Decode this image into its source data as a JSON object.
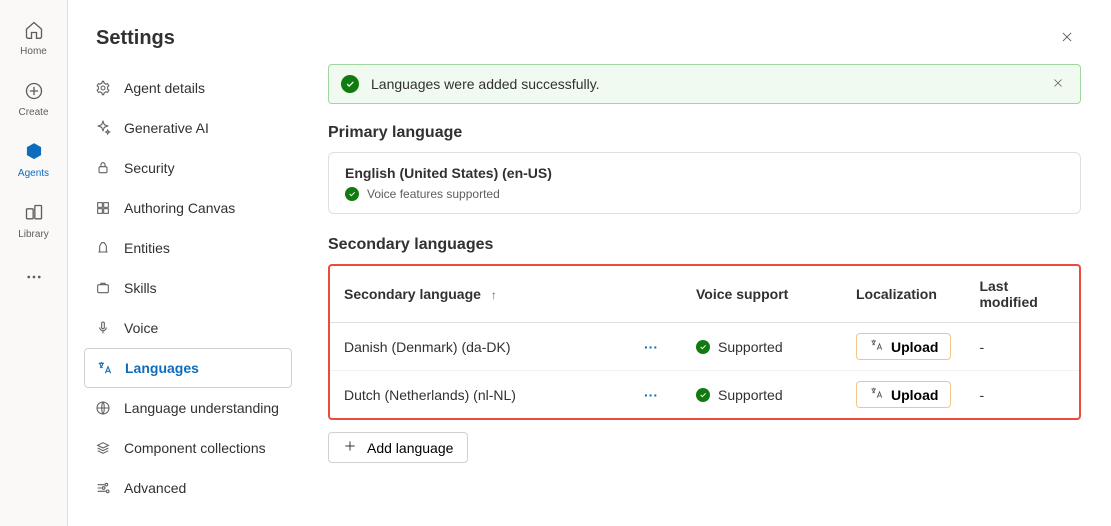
{
  "rail": {
    "home": {
      "label": "Home"
    },
    "create": {
      "label": "Create"
    },
    "agents": {
      "label": "Agents"
    },
    "library": {
      "label": "Library"
    }
  },
  "page": {
    "title": "Settings"
  },
  "settings_nav": {
    "items": [
      {
        "key": "agent-details",
        "label": "Agent details"
      },
      {
        "key": "generative-ai",
        "label": "Generative AI"
      },
      {
        "key": "security",
        "label": "Security"
      },
      {
        "key": "authoring-canvas",
        "label": "Authoring Canvas"
      },
      {
        "key": "entities",
        "label": "Entities"
      },
      {
        "key": "skills",
        "label": "Skills"
      },
      {
        "key": "voice",
        "label": "Voice"
      },
      {
        "key": "languages",
        "label": "Languages",
        "active": true
      },
      {
        "key": "language-understanding",
        "label": "Language understanding"
      },
      {
        "key": "component-collections",
        "label": "Component collections"
      },
      {
        "key": "advanced",
        "label": "Advanced"
      }
    ]
  },
  "banner": {
    "message": "Languages were added successfully."
  },
  "primary": {
    "heading": "Primary language",
    "name": "English (United States) (en-US)",
    "voice_note": "Voice features supported"
  },
  "secondary": {
    "heading": "Secondary languages",
    "columns": {
      "lang": "Secondary language",
      "voice": "Voice support",
      "loc": "Localization",
      "modified": "Last modified"
    },
    "rows": [
      {
        "lang": "Danish (Denmark) (da-DK)",
        "voice": "Supported",
        "loc_button": "Upload",
        "modified": "-"
      },
      {
        "lang": "Dutch (Netherlands) (nl-NL)",
        "voice": "Supported",
        "loc_button": "Upload",
        "modified": "-"
      }
    ],
    "add_button": "Add language"
  }
}
